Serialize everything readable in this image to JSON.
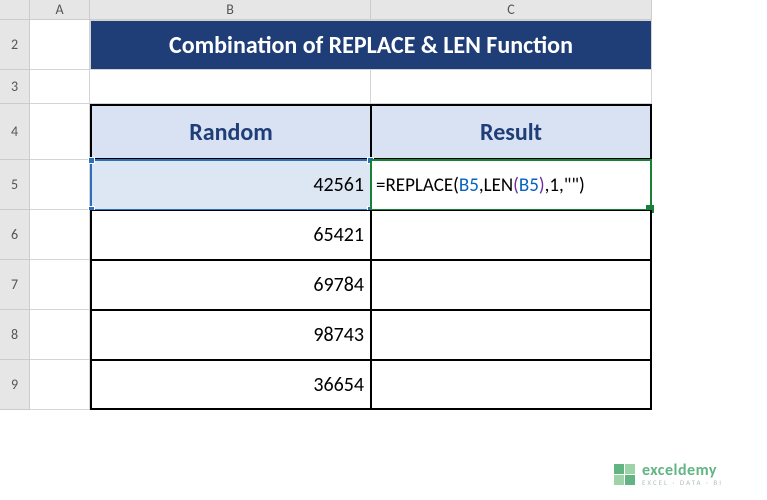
{
  "columns": {
    "corner": "",
    "A": "A",
    "B": "B",
    "C": "C"
  },
  "rows": {
    "r2": "2",
    "r3": "3",
    "r4": "4",
    "r5": "5",
    "r6": "6",
    "r7": "7",
    "r8": "8",
    "r9": "9"
  },
  "title": "Combination of REPLACE & LEN Function",
  "headers": {
    "random": "Random",
    "result": "Result"
  },
  "dataB": {
    "b5": "42561",
    "b6": "65421",
    "b7": "69784",
    "b8": "98743",
    "b9": "36654"
  },
  "formula": {
    "eq": "=",
    "fn1": "REPLACE",
    "open1": "(",
    "arg1": "B5",
    "comma1": ",",
    "fn2": "LEN",
    "open2": "(",
    "arg2": "B5",
    "close2": ")",
    "comma2": ",",
    "arg3": "1",
    "comma3": ",",
    "quote": "\"\"",
    "close1": ")"
  },
  "watermark": {
    "name": "exceldemy",
    "tagline": "EXCEL · DATA · BI"
  },
  "chart_data": {
    "type": "table",
    "title": "Combination of REPLACE & LEN Function",
    "columns": [
      "Random",
      "Result"
    ],
    "rows": [
      {
        "Random": 42561,
        "Result": "=REPLACE(B5,LEN(B5),1,\"\")"
      },
      {
        "Random": 65421,
        "Result": ""
      },
      {
        "Random": 69784,
        "Result": ""
      },
      {
        "Random": 98743,
        "Result": ""
      },
      {
        "Random": 36654,
        "Result": ""
      }
    ]
  }
}
